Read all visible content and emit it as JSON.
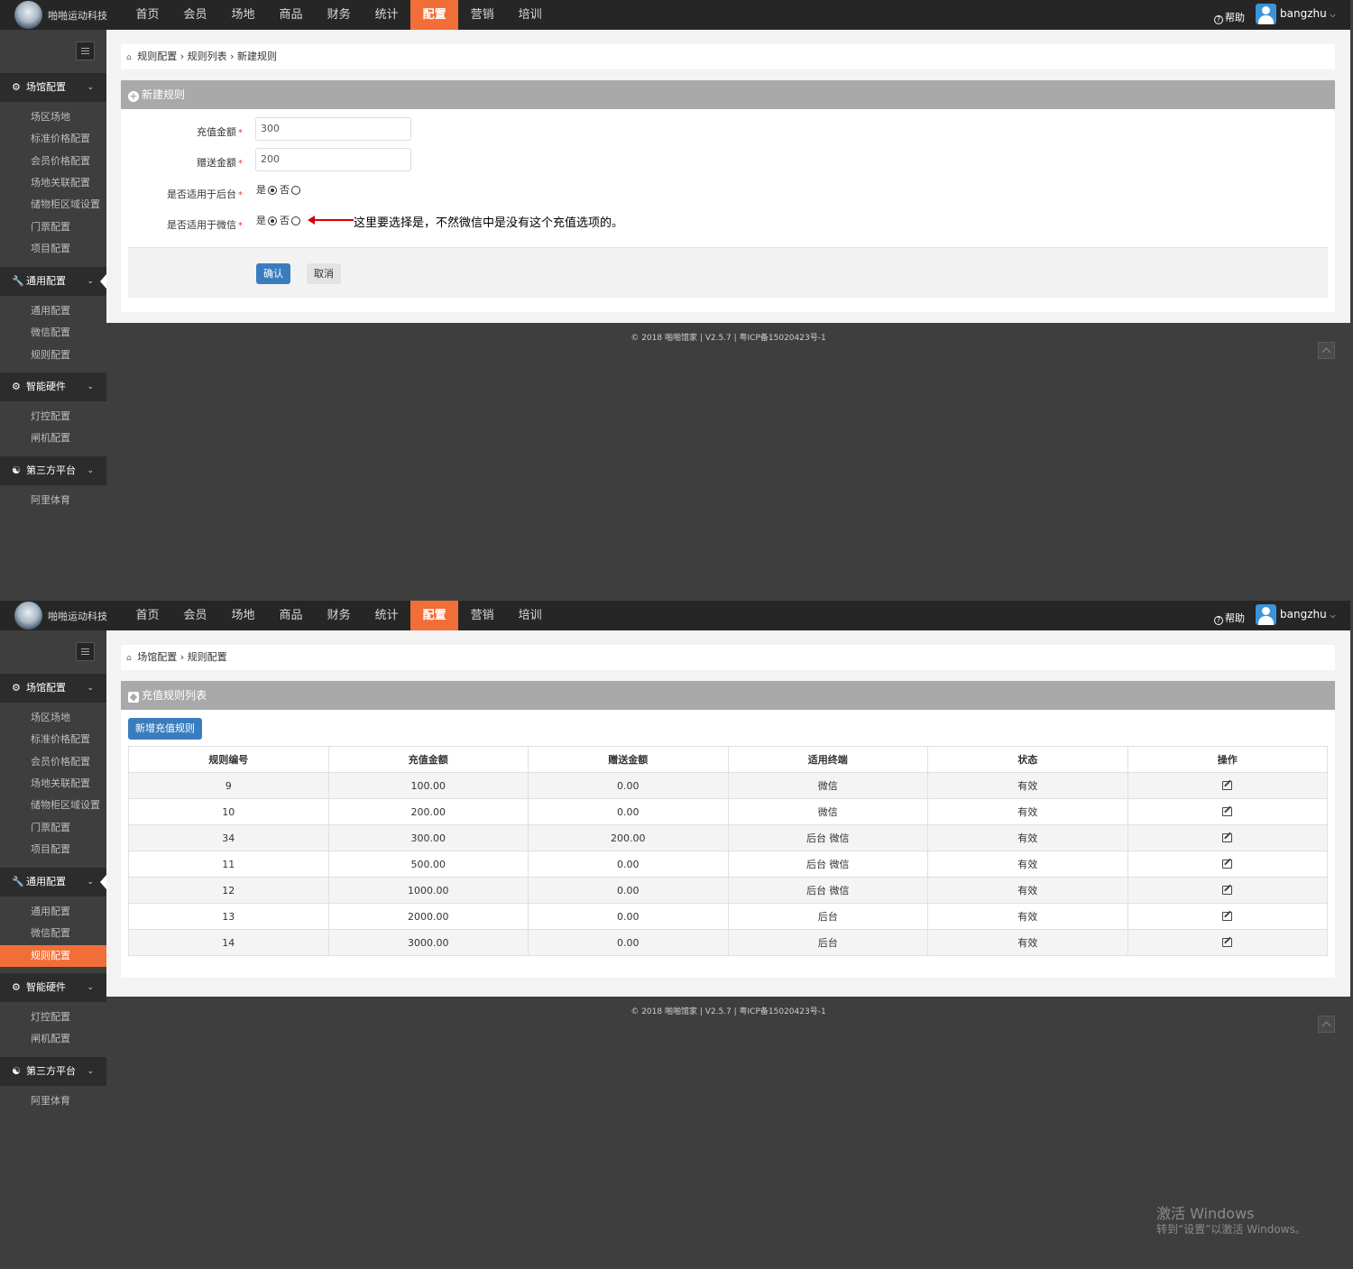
{
  "header": {
    "logo_text": "啪啪运动科技",
    "nav": [
      "首页",
      "会员",
      "场地",
      "商品",
      "财务",
      "统计",
      "配置",
      "营销",
      "培训"
    ],
    "active_nav": "配置",
    "help": "帮助",
    "user": "bangzhu"
  },
  "sidebar": {
    "groups": [
      {
        "label": "场馆配置",
        "icon": "gears-icon",
        "items": [
          "场区场地",
          "标准价格配置",
          "会员价格配置",
          "场地关联配置",
          "储物柜区域设置",
          "门票配置",
          "项目配置"
        ]
      },
      {
        "label": "通用配置",
        "icon": "wrench-icon",
        "items": [
          "通用配置",
          "微信配置",
          "规则配置"
        ]
      },
      {
        "label": "智能硬件",
        "icon": "cog-icon",
        "items": [
          "灯控配置",
          "闸机配置"
        ]
      },
      {
        "label": "第三方平台",
        "icon": "handshake-icon",
        "items": [
          "阿里体育"
        ]
      }
    ]
  },
  "screen1": {
    "breadcrumb": [
      "规则配置",
      "规则列表",
      "新建规则"
    ],
    "box_title": "新建规则",
    "form": {
      "recharge_label": "充值金额",
      "recharge_value": "300",
      "bonus_label": "赠送金额",
      "bonus_value": "200",
      "backend_label": "是否适用于后台",
      "wechat_label": "是否适用于微信",
      "yes": "是",
      "no": "否",
      "backend_selected": "是",
      "wechat_selected": "是"
    },
    "annotation": "这里要选择是，不然微信中是没有这个充值选项的。",
    "confirm": "确认",
    "cancel": "取消"
  },
  "screen2": {
    "breadcrumb": [
      "场馆配置",
      "规则配置"
    ],
    "box_title": "充值规则列表",
    "add_button": "新增充值规则",
    "columns": [
      "规则编号",
      "充值金额",
      "赠送金额",
      "适用终端",
      "状态",
      "操作"
    ],
    "rows": [
      [
        "9",
        "100.00",
        "0.00",
        "微信",
        "有效"
      ],
      [
        "10",
        "200.00",
        "0.00",
        "微信",
        "有效"
      ],
      [
        "34",
        "300.00",
        "200.00",
        "后台 微信",
        "有效"
      ],
      [
        "11",
        "500.00",
        "0.00",
        "后台 微信",
        "有效"
      ],
      [
        "12",
        "1000.00",
        "0.00",
        "后台 微信",
        "有效"
      ],
      [
        "13",
        "2000.00",
        "0.00",
        "后台",
        "有效"
      ],
      [
        "14",
        "3000.00",
        "0.00",
        "后台",
        "有效"
      ]
    ],
    "active_side_item": "规则配置"
  },
  "footer": "© 2018 啪啪馆家 | V2.5.7 | 粤ICP备15020423号-1",
  "watermark": {
    "line1": "激活 Windows",
    "line2": "转到“设置”以激活 Windows。"
  },
  "colors": {
    "accent": "#f26e38",
    "primary_button": "#3a7dbf",
    "topbar": "#262626",
    "sidebar": "#3e3e3e"
  }
}
